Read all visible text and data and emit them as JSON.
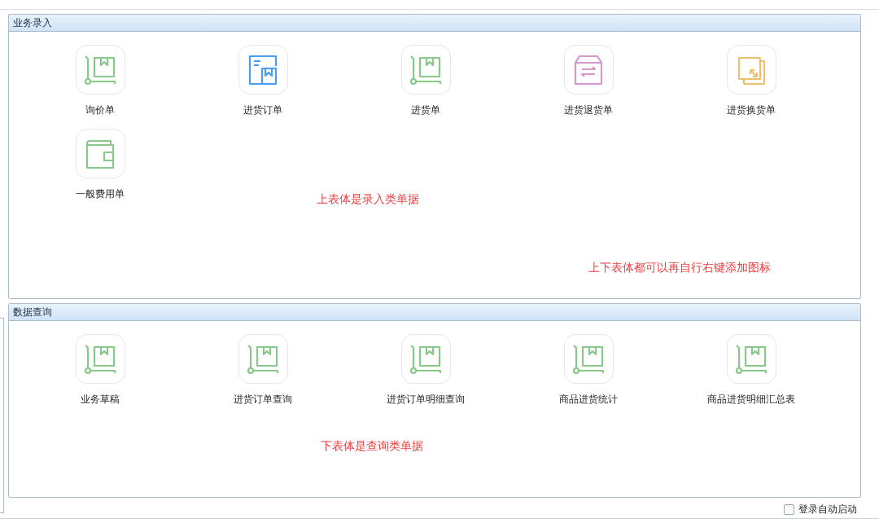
{
  "sections": [
    {
      "title": "业务录入",
      "items": [
        {
          "label": "询价单",
          "kind": "cart",
          "color": "#88c98a"
        },
        {
          "label": "进货订单",
          "kind": "order",
          "color": "#4a9cf2"
        },
        {
          "label": "进货单",
          "kind": "cart",
          "color": "#88c98a"
        },
        {
          "label": "进货退货单",
          "kind": "box",
          "color": "#d697cf"
        },
        {
          "label": "进货换货单",
          "kind": "exchange",
          "color": "#eec06e"
        },
        {
          "label": "一般费用单",
          "kind": "wallet",
          "color": "#88c98a"
        }
      ],
      "notes": [
        "上表体是录入类单据",
        "上下表体都可以再自行右键添加图标"
      ]
    },
    {
      "title": "数据查询",
      "items": [
        {
          "label": "业务草稿",
          "kind": "cart",
          "color": "#88c98a"
        },
        {
          "label": "进货订单查询",
          "kind": "cart",
          "color": "#88c98a"
        },
        {
          "label": "进货订单明细查询",
          "kind": "cart",
          "color": "#88c98a"
        },
        {
          "label": "商品进货统计",
          "kind": "cart",
          "color": "#88c98a"
        },
        {
          "label": "商品进货明细汇总表",
          "kind": "cart",
          "color": "#88c98a"
        }
      ],
      "notes": [
        "下表体是查询类单据"
      ]
    }
  ],
  "auto_start": {
    "label": "登录自动启动",
    "checked": false
  }
}
